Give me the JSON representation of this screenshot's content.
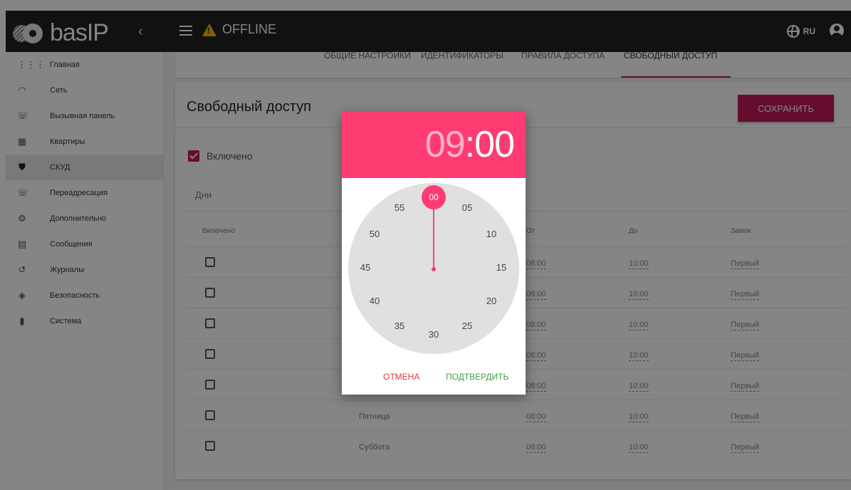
{
  "topbar": {
    "logo": "basIP",
    "collapse_glyph": "‹",
    "status": "OFFLINE",
    "lang": "RU"
  },
  "sidebar": {
    "items": [
      {
        "label": "Главная",
        "icon": "apps-icon"
      },
      {
        "label": "Сеть",
        "icon": "wifi-icon"
      },
      {
        "label": "Вызывная панель",
        "icon": "phone-icon"
      },
      {
        "label": "Квартиры",
        "icon": "building-icon"
      },
      {
        "label": "СКУД",
        "icon": "shield-check-icon",
        "active": true
      },
      {
        "label": "Переадресация",
        "icon": "phone-forward-icon"
      },
      {
        "label": "Дополнительно",
        "icon": "gear-icon"
      },
      {
        "label": "Сообщения",
        "icon": "message-icon"
      },
      {
        "label": "Журналы",
        "icon": "history-icon"
      },
      {
        "label": "Безопасность",
        "icon": "security-icon"
      },
      {
        "label": "Система",
        "icon": "device-icon"
      }
    ]
  },
  "tabs": [
    "Общие настройки",
    "Идентификаторы",
    "Правила доступа",
    "Свободный доступ"
  ],
  "active_tab": "Свободный доступ",
  "card": {
    "title": "Свободный доступ",
    "save_label": "СОХРАНИТЬ",
    "enabled_label": "Включено",
    "days_label": "Дни",
    "headers": {
      "enabled": "Включено",
      "from": "От",
      "to": "До",
      "lock": "Замок"
    },
    "rows": [
      {
        "day": "",
        "from": "08:00",
        "to": "10:00",
        "lock": "Первый"
      },
      {
        "day": "",
        "from": "08:00",
        "to": "10:00",
        "lock": "Первый"
      },
      {
        "day": "",
        "from": "08:00",
        "to": "10:00",
        "lock": "Первый"
      },
      {
        "day": "",
        "from": "08:00",
        "to": "10:00",
        "lock": "Первый"
      },
      {
        "day": "",
        "from": "08:00",
        "to": "10:00",
        "lock": "Первый"
      },
      {
        "day": "Пятница",
        "from": "08:00",
        "to": "10:00",
        "lock": "Первый"
      },
      {
        "day": "Суббота",
        "from": "08:00",
        "to": "10:00",
        "lock": "Первый"
      }
    ]
  },
  "dialog": {
    "hours": "09",
    "separator": ":",
    "minutes": "00",
    "selected": "00",
    "dial": [
      "00",
      "05",
      "10",
      "15",
      "20",
      "25",
      "30",
      "35",
      "40",
      "45",
      "50",
      "55"
    ],
    "cancel_label": "ОТМЕНА",
    "confirm_label": "ПОДТВЕРДИТЬ"
  },
  "colors": {
    "accent": "#c2185b",
    "picker": "#ff3c72",
    "topbar": "#212121"
  }
}
